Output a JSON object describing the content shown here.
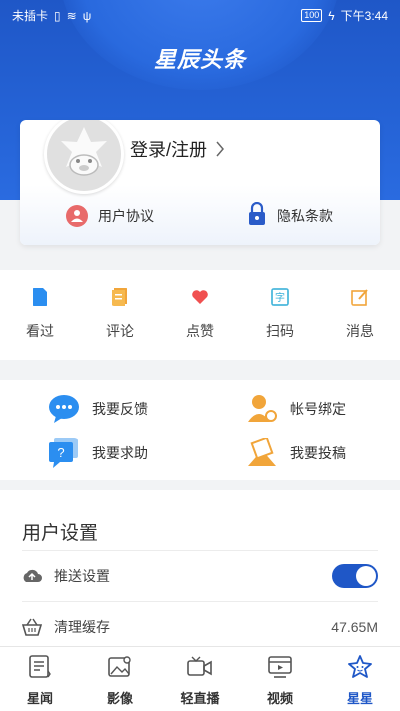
{
  "status_bar": {
    "carrier": "未插卡",
    "battery": "100",
    "time": "下午3:44"
  },
  "header": {
    "brand": "星辰头条"
  },
  "account_card": {
    "login_label": "登录/注册",
    "links": [
      {
        "label": "用户协议",
        "icon": "user-agreement-icon",
        "color": "#e35d5d"
      },
      {
        "label": "隐私条款",
        "icon": "lock-icon",
        "color": "#2a5bc8"
      }
    ]
  },
  "quick_actions": [
    {
      "label": "看过",
      "icon": "document-icon",
      "color": "#2b8ef0"
    },
    {
      "label": "评论",
      "icon": "comment-list-icon",
      "color": "#f1a53a"
    },
    {
      "label": "点赞",
      "icon": "heart-icon",
      "color": "#f05050"
    },
    {
      "label": "扫码",
      "icon": "scan-icon",
      "color": "#39b0d8"
    },
    {
      "label": "消息",
      "icon": "edit-message-icon",
      "color": "#f1a53a"
    }
  ],
  "services": [
    {
      "label": "我要反馈",
      "icon": "feedback-bubble-icon",
      "color": "#2b8ef0"
    },
    {
      "label": "帐号绑定",
      "icon": "account-bind-icon",
      "color": "#f1a53a"
    },
    {
      "label": "我要求助",
      "icon": "help-bubble-icon",
      "color": "#2b8ef0"
    },
    {
      "label": "我要投稿",
      "icon": "submit-envelope-icon",
      "color": "#f1a53a"
    }
  ],
  "settings": {
    "title": "用户设置",
    "push_label": "推送设置",
    "push_enabled": true,
    "cache_label": "清理缓存",
    "cache_size": "47.65M"
  },
  "tabbar": [
    {
      "label": "星闻",
      "icon": "news-icon",
      "active": false
    },
    {
      "label": "影像",
      "icon": "gallery-icon",
      "active": false
    },
    {
      "label": "轻直播",
      "icon": "live-camera-icon",
      "active": false
    },
    {
      "label": "视频",
      "icon": "video-icon",
      "active": false
    },
    {
      "label": "星星",
      "icon": "star-icon",
      "active": true
    }
  ],
  "colors": {
    "brand_blue": "#1f57c7",
    "toggle_on": "#1f57c7"
  }
}
